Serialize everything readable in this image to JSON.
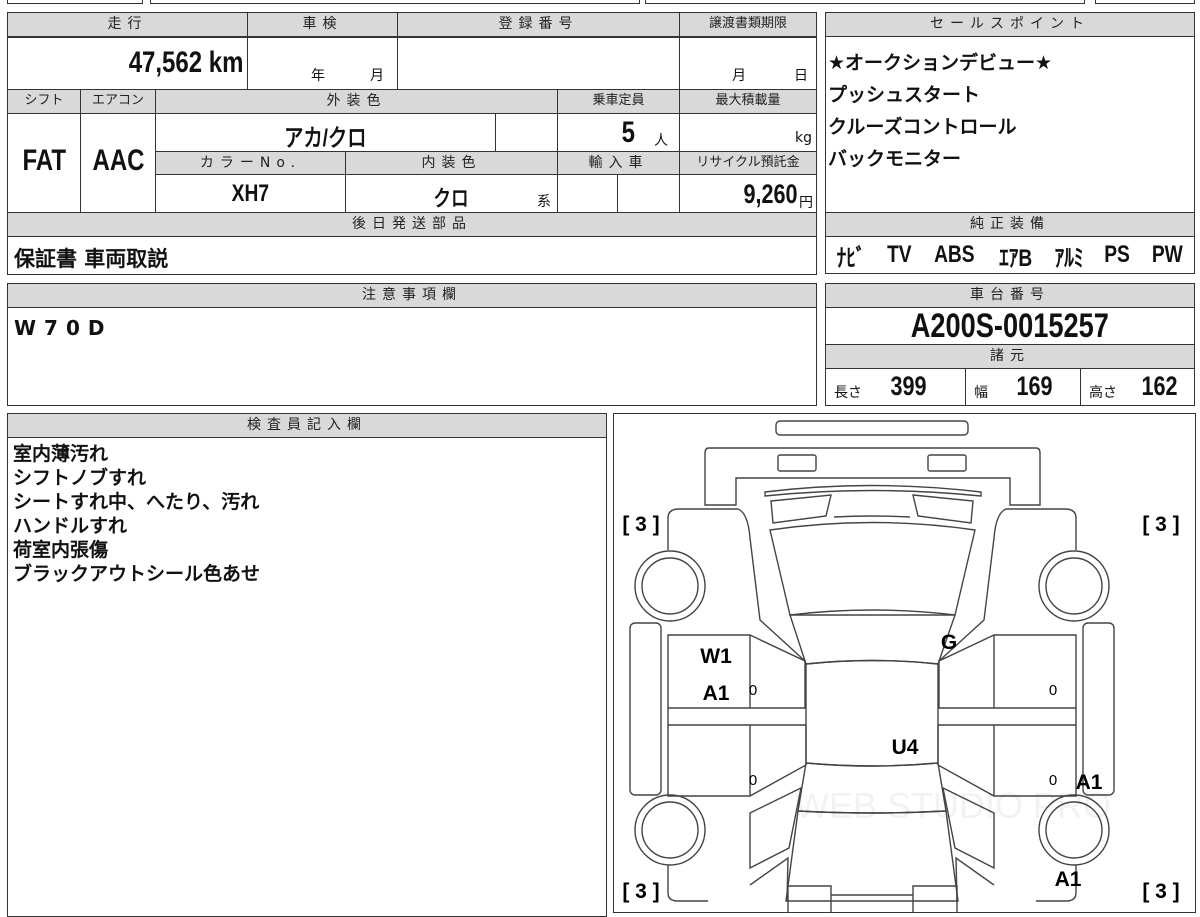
{
  "main_table": {
    "headers": {
      "mileage": "走行",
      "inspection": "車検",
      "registration_no": "登録番号",
      "transfer_deadline": "譲渡書類期限",
      "shift": "シフト",
      "aircon": "エアコン",
      "exterior_color": "外装色",
      "capacity": "乗車定員",
      "max_load": "最大積載量",
      "color_no": "カラーNo.",
      "interior_color": "内装色",
      "import": "輸入車",
      "recycle_fee": "リサイクル預託金",
      "later_parts": "後日発送部品"
    },
    "mileage_value": "47,562",
    "mileage_unit": "km",
    "inspection_year": "年",
    "inspection_month": "月",
    "deadline_month": "月",
    "deadline_day": "日",
    "shift_value": "FAT",
    "aircon_value": "AAC",
    "exterior_color_value": "アカ/クロ",
    "capacity_value": "5",
    "capacity_unit": "人",
    "max_load_unit": "kg",
    "color_no_value": "XH7",
    "interior_color_value": "クロ",
    "interior_suffix": "系",
    "recycle_value": "9,260",
    "recycle_unit": "円",
    "later_parts_value": "保証書 車両取説"
  },
  "sales_points": {
    "header": "セールスポイント",
    "items": [
      "★オークションデビュー★",
      "プッシュスタート",
      "クルーズコントロール",
      "バックモニター"
    ]
  },
  "equipment": {
    "header": "純正装備",
    "items": [
      "ﾅﾋﾞ",
      "TV",
      "ABS",
      "ｴｱB",
      "ｱﾙﾐ",
      "PS",
      "PW"
    ]
  },
  "notes": {
    "header": "注意事項欄",
    "value": "W70D"
  },
  "chassis": {
    "header": "車台番号",
    "value": "A200S-0015257",
    "specs_header": "諸元",
    "length_label": "長さ",
    "length": "399",
    "width_label": "幅",
    "width": "169",
    "height_label": "高さ",
    "height": "162"
  },
  "inspector": {
    "header": "検査員記入欄",
    "items": [
      "室内薄汚れ",
      "シフトノブすれ",
      "シートすれ中、へたり、汚れ",
      "ハンドルすれ",
      "荷室内張傷",
      "ブラックアウトシール色あせ"
    ]
  },
  "diagram": {
    "tire_fl": "[ 3 ]",
    "tire_fr": "[ 3 ]",
    "tire_rl": "[ 3 ]",
    "tire_rr": "[ 3 ]",
    "marks": {
      "front_left_door_1": "W1",
      "front_left_door_2": "A1",
      "windshield_lower": "G",
      "roof": "U4",
      "rear_right_door": "A1",
      "rear_right_fender": "A1",
      "zero_fl": "0",
      "zero_rl": "0",
      "zero_fr": "0",
      "zero_rr": "0"
    },
    "watermark": "WEB STUDIO PRO"
  }
}
